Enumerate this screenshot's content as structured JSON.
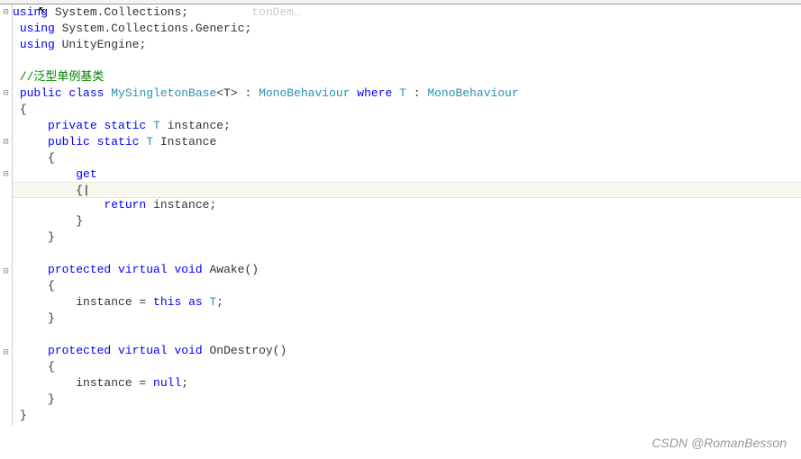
{
  "tab_hint": "tonDem…",
  "code": {
    "l1a": "using",
    "l1b": " System.Collections;",
    "l2a": "using",
    "l2b": " System.Collections.Generic;",
    "l3a": "using",
    "l3b": " UnityEngine;",
    "comment": "//泛型单例基类",
    "l6_public": "public",
    "l6_class": " class ",
    "l6_name": "MySingletonBase",
    "l6_t": "<T> : ",
    "l6_mono": "MonoBehaviour",
    "l6_where": " where ",
    "l6_t2": "T",
    "l6_colon": " : ",
    "l6_mono2": "MonoBehaviour",
    "brace_open": "{",
    "brace_close": "}",
    "l8a": "private",
    "l8b": " static ",
    "l8c": "T",
    "l8d": " instance;",
    "l9a": "public",
    "l9b": " static ",
    "l9c": "T",
    "l9d": " Instance",
    "get": "get",
    "l13a": "return",
    "l13b": " instance;",
    "l17a": "protected",
    "l17b": " virtual ",
    "l17c": "void",
    "l17d": " Awake()",
    "l19": "instance = ",
    "l19b": "this",
    "l19c": " as ",
    "l19d": "T",
    "l19e": ";",
    "l22a": "protected",
    "l22b": " virtual ",
    "l22c": "void",
    "l22d": " OnDestroy()",
    "l24": "instance = ",
    "l24b": "null",
    "l24c": ";"
  },
  "watermark": "CSDN @RomanBesson"
}
